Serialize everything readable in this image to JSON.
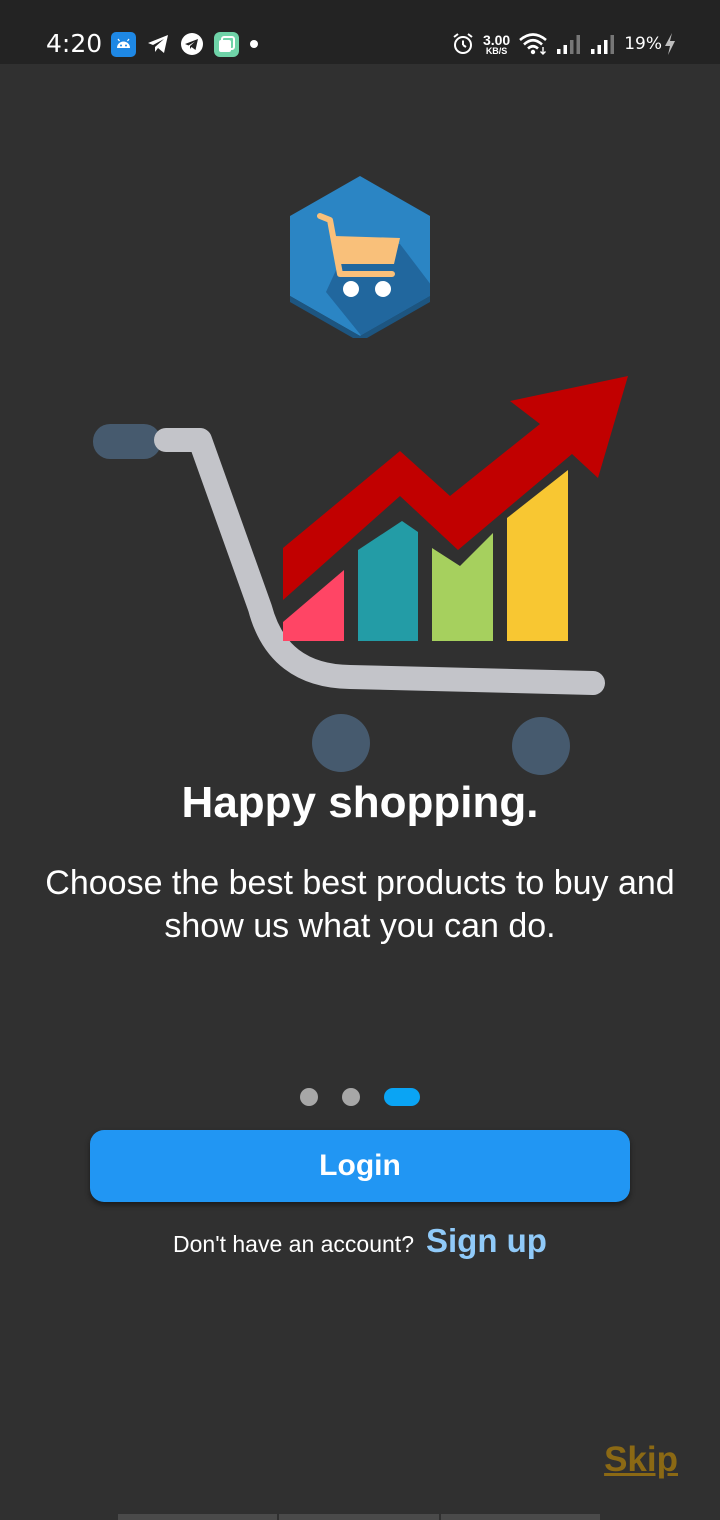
{
  "status_bar": {
    "time": "4:20",
    "speed_value": "3.00",
    "speed_unit": "KB/S",
    "battery": "19%"
  },
  "onboarding": {
    "title": "Happy shopping.",
    "description": "Choose the best best products to buy and show us what you can do.",
    "page_indicator": {
      "total": 3,
      "active_index": 3
    }
  },
  "actions": {
    "login_label": "Login",
    "signup_prompt": "Don't have an account?",
    "signup_label": "Sign up",
    "skip_label": "Skip"
  },
  "colors": {
    "background": "#303030",
    "status_bar": "#232323",
    "primary": "#2196f3",
    "signup_link": "#90caf9",
    "skip_link": "#8b6914",
    "indicator_active": "#0aa4f4",
    "indicator_inactive": "#a7a7a7"
  },
  "icons": {
    "notifications": [
      "android-icon",
      "telegram-icon",
      "telegram-circle-icon",
      "copy-app-icon",
      "dot-icon"
    ],
    "system": [
      "alarm-icon",
      "wifi-icon",
      "signal-icon",
      "signal-icon",
      "charging-icon"
    ]
  }
}
